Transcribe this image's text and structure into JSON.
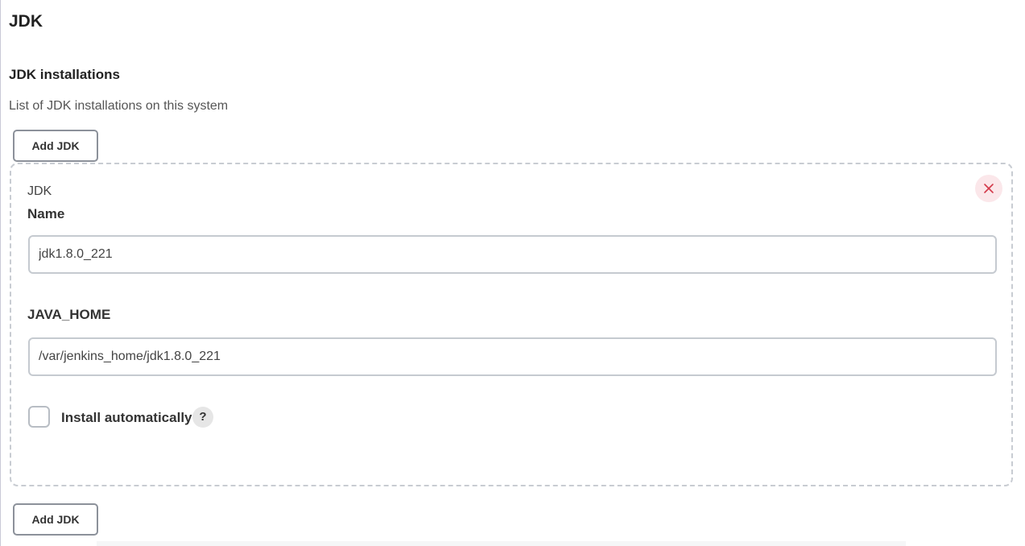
{
  "section": {
    "title": "JDK",
    "installations_label": "JDK installations",
    "installations_description": "List of JDK installations on this system",
    "add_button_label": "Add JDK"
  },
  "jdk_entry": {
    "heading": "JDK",
    "name_label": "Name",
    "name_value": "jdk1.8.0_221",
    "java_home_label": "JAVA_HOME",
    "java_home_value": "/var/jenkins_home/jdk1.8.0_221",
    "install_automatically_label": "Install automatically",
    "install_automatically_checked": false,
    "help_icon": "question-mark-icon",
    "help_glyph": "?",
    "delete_icon": "close-icon"
  },
  "colors": {
    "delete_accent": "#d33a4a",
    "delete_background": "#fbe7ea",
    "border": "#c5cad0"
  }
}
